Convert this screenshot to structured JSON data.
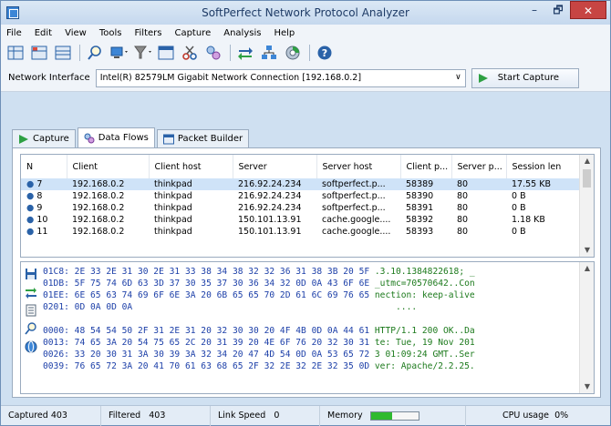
{
  "window": {
    "title": "SoftPerfect Network Protocol Analyzer",
    "min": "–",
    "max": "🗗",
    "close": "✕"
  },
  "menu": [
    "File",
    "Edit",
    "View",
    "Tools",
    "Filters",
    "Capture",
    "Analysis",
    "Help"
  ],
  "toolbar_icons": [
    "grid-icon",
    "grid-icon",
    "grid-icon",
    "search-icon",
    "computer-icon",
    "filter-icon",
    "table-icon",
    "cut-icon",
    "connection-icon",
    "arrows-icon",
    "network-icon",
    "disc-icon",
    "help-icon"
  ],
  "network": {
    "label": "Network Interface",
    "value": "Intel(R) 82579LM Gigabit Network Connection [192.168.0.2]",
    "start_label": "Start Capture"
  },
  "tabs": [
    {
      "label": "Capture",
      "active": false
    },
    {
      "label": "Data Flows",
      "active": true
    },
    {
      "label": "Packet Builder",
      "active": false
    }
  ],
  "flows": {
    "columns": [
      "N",
      "Client",
      "Client host",
      "Server",
      "Server host",
      "Client p...",
      "Server p...",
      "Session len"
    ],
    "rows": [
      [
        "7",
        "192.168.0.2",
        "thinkpad",
        "216.92.24.234",
        "softperfect.p...",
        "58389",
        "80",
        "17.55 KB"
      ],
      [
        "8",
        "192.168.0.2",
        "thinkpad",
        "216.92.24.234",
        "softperfect.p...",
        "58390",
        "80",
        "0 B"
      ],
      [
        "9",
        "192.168.0.2",
        "thinkpad",
        "216.92.24.234",
        "softperfect.p...",
        "58391",
        "80",
        "0 B"
      ],
      [
        "10",
        "192.168.0.2",
        "thinkpad",
        "150.101.13.91",
        "cache.google....",
        "58392",
        "80",
        "1.18 KB"
      ],
      [
        "11",
        "192.168.0.2",
        "thinkpad",
        "150.101.13.91",
        "cache.google....",
        "58393",
        "80",
        "0 B"
      ]
    ],
    "selected_index": 0
  },
  "hex": [
    {
      "off": "01C8:",
      "hex": "2E 33 2E 31 30 2E 31 33 38 34 38 32 32 36 31 38 3B 20 5F",
      "asc": ".3.10.1384822618; _"
    },
    {
      "off": "01DB:",
      "hex": "5F 75 74 6D 63 3D 37 30 35 37 30 36 34 32 0D 0A 43 6F 6E",
      "asc": "_utmc=70570642..Con"
    },
    {
      "off": "01EE:",
      "hex": "6E 65 63 74 69 6F 6E 3A 20 6B 65 65 70 2D 61 6C 69 76 65",
      "asc": "nection: keep-alive"
    },
    {
      "off": "0201:",
      "hex": "0D 0A 0D 0A",
      "asc": "...."
    },
    {
      "off": "",
      "hex": "",
      "asc": ""
    },
    {
      "off": "0000:",
      "hex": "48 54 54 50 2F 31 2E 31 20 32 30 30 20 4F 4B 0D 0A 44 61",
      "asc": "HTTP/1.1 200 OK..Da"
    },
    {
      "off": "0013:",
      "hex": "74 65 3A 20 54 75 65 2C 20 31 39 20 4E 6F 76 20 32 30 31",
      "asc": "te: Tue, 19 Nov 201"
    },
    {
      "off": "0026:",
      "hex": "33 20 30 31 3A 30 39 3A 32 34 20 47 4D 54 0D 0A 53 65 72",
      "asc": "3 01:09:24 GMT..Ser"
    },
    {
      "off": "0039:",
      "hex": "76 65 72 3A 20 41 70 61 63 68 65 2F 32 2E 32 2E 32 35 0D",
      "asc": "ver: Apache/2.2.25."
    }
  ],
  "status": {
    "captured_label": "Captured",
    "captured_value": "403",
    "filtered_label": "Filtered",
    "filtered_value": "403",
    "speed_label": "Link Speed",
    "speed_value": "0",
    "memory_label": "Memory",
    "memory_fraction": 0.45,
    "cpu_label": "CPU usage",
    "cpu_value": "0%"
  },
  "colors": {
    "accent": "#3d86d6",
    "memory_fill": "#2fba2f",
    "selected_row": "#cfe3f8"
  }
}
